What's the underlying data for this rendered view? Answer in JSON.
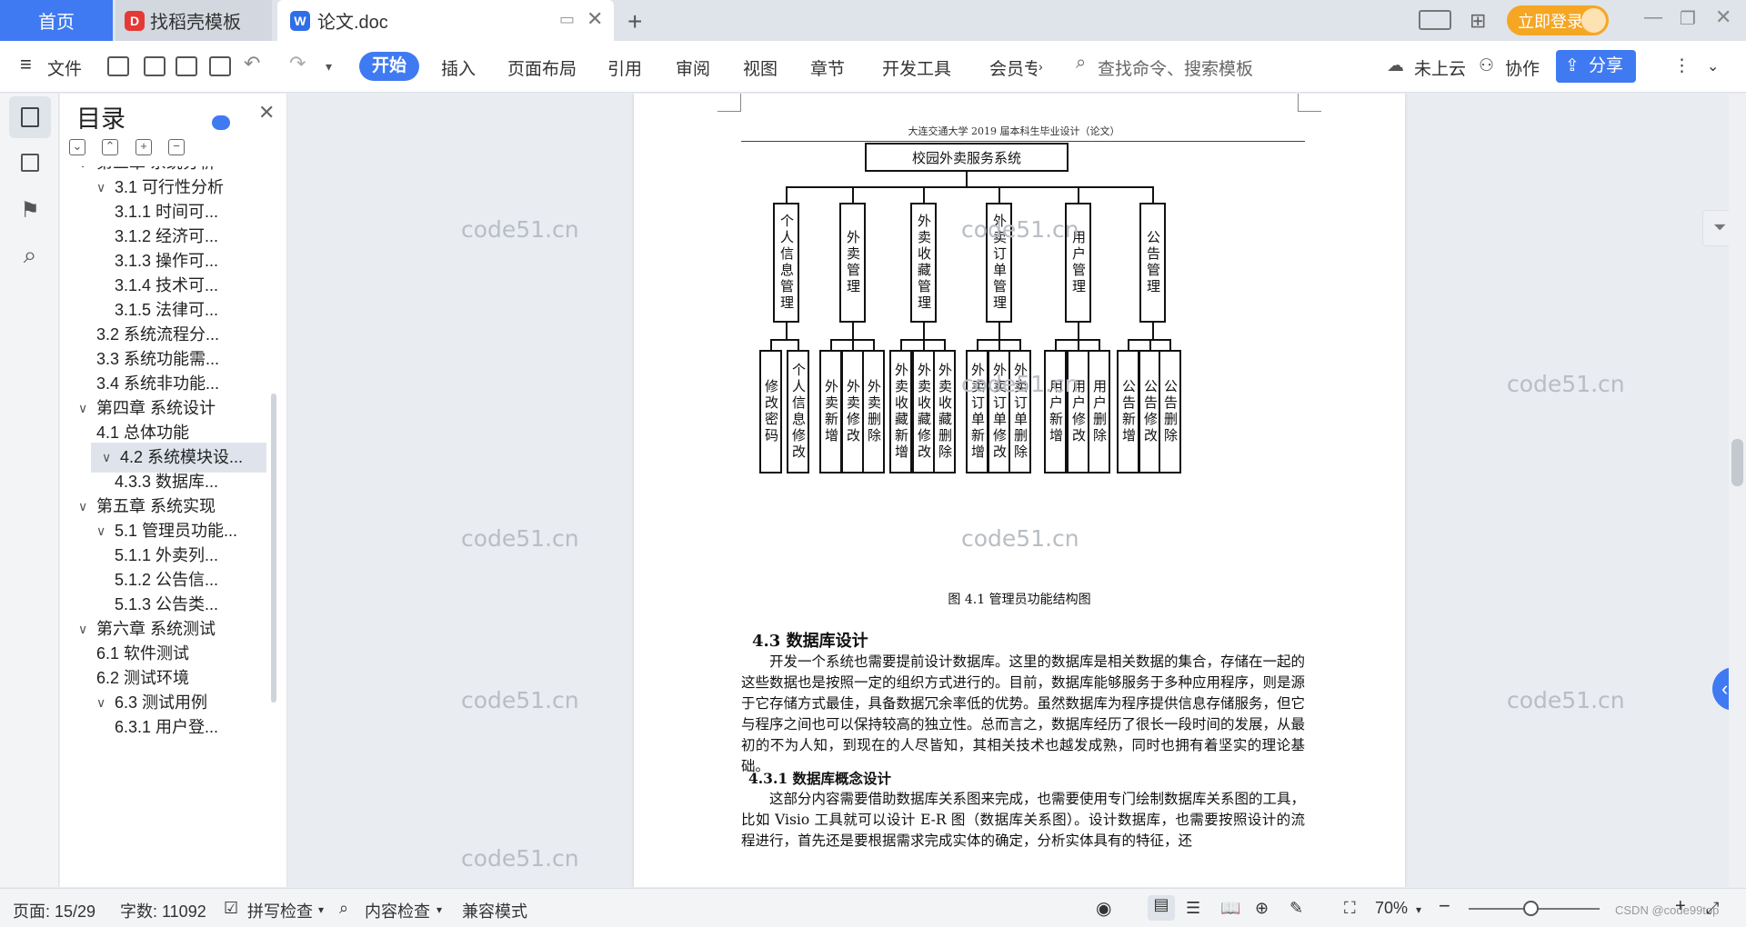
{
  "tabs": {
    "home": "首页",
    "daoke": "找稻壳模板",
    "doc": "论文.doc",
    "login": "立即登录"
  },
  "toolbar": {
    "file": "文件",
    "menu": [
      "开始",
      "插入",
      "页面布局",
      "引用",
      "审阅",
      "视图",
      "章节",
      "开发工具",
      "会员专"
    ],
    "search_placeholder": "查找命令、搜索模板",
    "cloud": "未上云",
    "collab": "协作",
    "share": "分享"
  },
  "toc": {
    "title": "目录",
    "items": [
      {
        "label": "第三章 系统分析",
        "level": 0,
        "arrow": "v"
      },
      {
        "label": "3.1 可行性分析",
        "level": 1,
        "arrow": "v"
      },
      {
        "label": "3.1.1 时间可...",
        "level": 2
      },
      {
        "label": "3.1.2 经济可...",
        "level": 2
      },
      {
        "label": "3.1.3 操作可...",
        "level": 2
      },
      {
        "label": "3.1.4 技术可...",
        "level": 2
      },
      {
        "label": "3.1.5 法律可...",
        "level": 2
      },
      {
        "label": "3.2 系统流程分...",
        "level": 1
      },
      {
        "label": "3.3 系统功能需...",
        "level": 1
      },
      {
        "label": "3.4 系统非功能...",
        "level": 1
      },
      {
        "label": "第四章 系统设计",
        "level": 0,
        "arrow": "v"
      },
      {
        "label": "4.1 总体功能",
        "level": 1
      },
      {
        "label": "4.2 系统模块设...",
        "level": 1,
        "arrow": "v",
        "selected": true
      },
      {
        "label": "4.3.3 数据库...",
        "level": 2
      },
      {
        "label": "第五章 系统实现",
        "level": 0,
        "arrow": "v"
      },
      {
        "label": "5.1 管理员功能...",
        "level": 1,
        "arrow": "v"
      },
      {
        "label": "5.1.1 外卖列...",
        "level": 2
      },
      {
        "label": "5.1.2 公告信...",
        "level": 2
      },
      {
        "label": "5.1.3 公告类...",
        "level": 2
      },
      {
        "label": "第六章 系统测试",
        "level": 0,
        "arrow": "v"
      },
      {
        "label": "6.1 软件测试",
        "level": 1
      },
      {
        "label": "6.2 测试环境",
        "level": 1
      },
      {
        "label": "6.3 测试用例",
        "level": 1,
        "arrow": "v"
      },
      {
        "label": "6.3.1 用户登...",
        "level": 2
      }
    ]
  },
  "document": {
    "running_head": "大连交通大学 2019 届本科生毕业设计（论文）",
    "diagram": {
      "root": "校园外卖服务系统",
      "groups": [
        {
          "name": "个人信息管理",
          "children": [
            "修改密码",
            "个人信息修改"
          ]
        },
        {
          "name": "外卖管理",
          "children": [
            "外卖新增",
            "外卖修改",
            "外卖删除"
          ]
        },
        {
          "name": "外卖收藏管理",
          "children": [
            "外卖收藏新增",
            "外卖收藏修改",
            "外卖收藏删除"
          ]
        },
        {
          "name": "外卖订单管理",
          "children": [
            "外卖订单新增",
            "外卖订单修改",
            "外卖订单删除"
          ]
        },
        {
          "name": "用户管理",
          "children": [
            "用户新增",
            "用户修改",
            "用户删除"
          ]
        },
        {
          "name": "公告管理",
          "children": [
            "公告新增",
            "公告修改",
            "公告删除"
          ]
        }
      ]
    },
    "caption": "图 4.1 管理员功能结构图",
    "section_43": "4.3  数据库设计",
    "para1": "开发一个系统也需要提前设计数据库。这里的数据库是相关数据的集合，存储在一起的这些数据也是按照一定的组织方式进行的。目前，数据库能够服务于多种应用程序，则是源于它存储方式最佳，具备数据冗余率低的优势。虽然数据库为程序提供信息存储服务，但它与程序之间也可以保持较高的独立性。总而言之，数据库经历了很长一段时间的发展，从最初的不为人知，到现在的人尽皆知，其相关技术也越发成熟，同时也拥有着坚实的理论基础。",
    "section_431": "4.3.1  数据库概念设计",
    "para2": "这部分内容需要借助数据库关系图来完成，也需要使用专门绘制数据库关系图的工具，比如 Visio 工具就可以设计 E-R 图（数据库关系图）。设计数据库，也需要按照设计的流程进行，首先还是要根据需求完成实体的确定，分析实体具有的特征，还"
  },
  "watermark": "code51.cn",
  "status": {
    "page": "页面: 15/29",
    "words": "字数: 11092",
    "spell": "拼写检查",
    "content": "内容检查",
    "compat": "兼容模式",
    "zoom": "70%",
    "csdn": "CSDN @code99top"
  }
}
